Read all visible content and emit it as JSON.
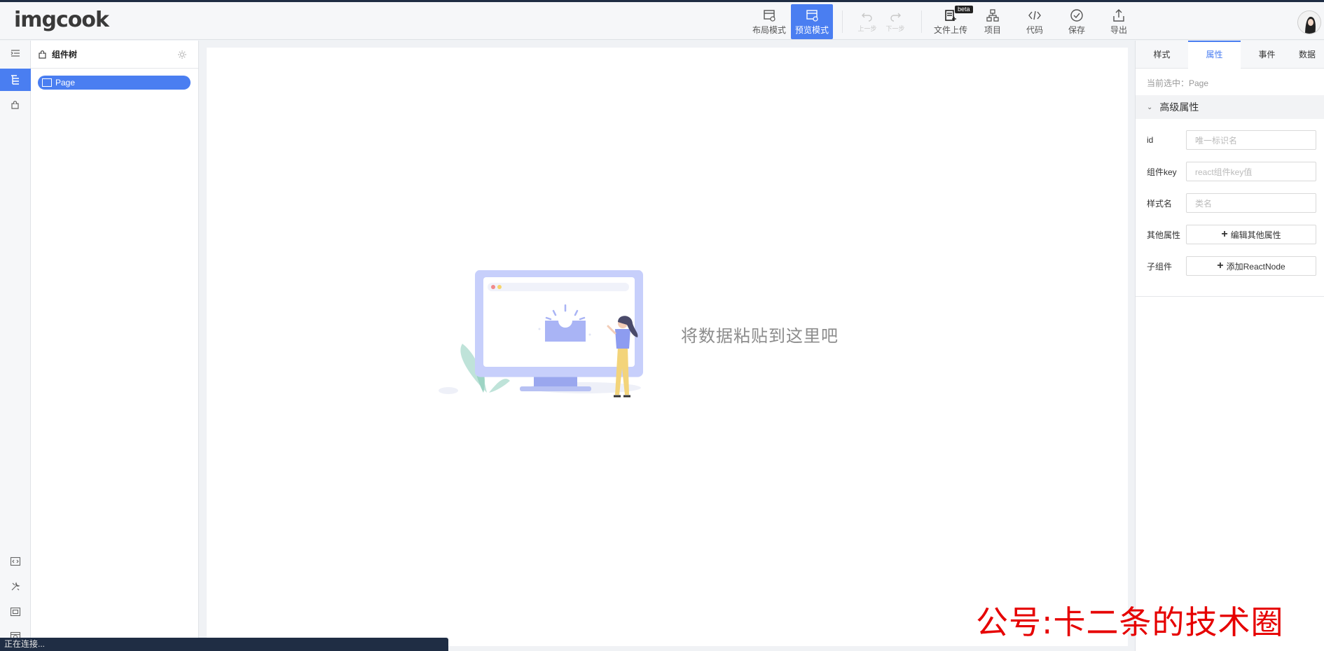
{
  "app": {
    "logo": "imgcook"
  },
  "toolbar": {
    "layout_mode": "布局模式",
    "preview_mode": "预览模式",
    "undo": "上一步",
    "redo": "下一步",
    "upload": "文件上传",
    "upload_badge": "beta",
    "project": "项目",
    "code": "代码",
    "save": "保存",
    "export": "导出"
  },
  "tree": {
    "title": "组件树",
    "nodes": [
      {
        "label": "Page"
      }
    ]
  },
  "canvas": {
    "empty_text": "将数据粘贴到这里吧"
  },
  "props_panel": {
    "tabs": [
      {
        "label": "样式"
      },
      {
        "label": "属性",
        "active": true
      },
      {
        "label": "事件"
      },
      {
        "label": "数据"
      }
    ],
    "current_label": "当前选中：Page",
    "section_title": "高级属性",
    "fields": [
      {
        "label": "id",
        "placeholder": "唯一标识名"
      },
      {
        "label": "组件key",
        "placeholder": "react组件key值"
      },
      {
        "label": "样式名",
        "placeholder": "类名"
      }
    ],
    "other_props": {
      "label": "其他属性",
      "button": "编辑其他属性"
    },
    "children": {
      "label": "子组件",
      "button": "添加ReactNode"
    }
  },
  "status": {
    "text": "正在连接..."
  },
  "watermark": {
    "text": "公号:卡二条的技术圈"
  },
  "colors": {
    "accent": "#4a7ef1",
    "statusbar": "#1f2d44",
    "watermark": "#e60000"
  }
}
